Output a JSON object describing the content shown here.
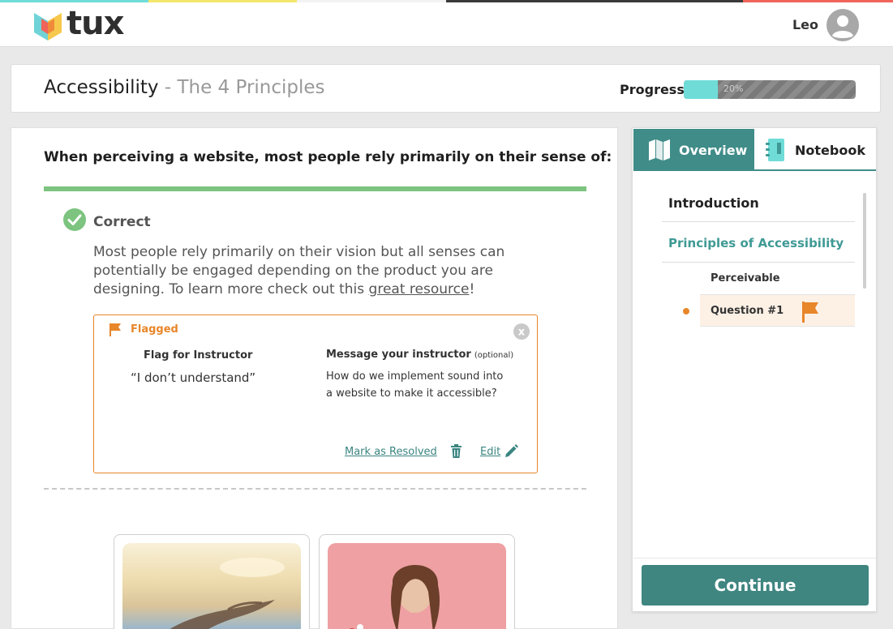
{
  "app": {
    "logo_text": "tux",
    "username": "Leo"
  },
  "course": {
    "title": "Accessibility",
    "subtitle": " - The 4 Principles"
  },
  "progress": {
    "label": "Progress",
    "value_text": "20%",
    "value": 0.2
  },
  "question": {
    "text": "When perceiving a website, most people rely primarily on their sense of:",
    "result": "Correct",
    "explanation": "Most people rely primarily on their vision but all senses can potentially be engaged depending on the product you are designing. To learn more check out this ",
    "link_text": "great resource",
    "explanation_end": "!"
  },
  "flag": {
    "status": "Flagged",
    "close_glyph": "x",
    "flag_for_instructor_label": "Flag for Instructor",
    "flag_reason": "“I don’t understand”",
    "message_label": "Message your instructor",
    "optional_label": "(optional)",
    "message": "How do we implement sound into a website to make it accessible?",
    "resolve_label": "Mark as Resolved",
    "edit_label": "Edit"
  },
  "sidebar": {
    "tabs": [
      {
        "label": "Overview",
        "icon": "map-icon",
        "active": true
      },
      {
        "label": "Notebook",
        "icon": "notebook-icon",
        "active": false
      }
    ],
    "nav": {
      "introduction": "Introduction",
      "section": "Principles of Accessibility",
      "subsection": "Perceivable",
      "current_item": "Question #1"
    },
    "continue_label": "Continue"
  },
  "colors": {
    "teal": "#3f8580",
    "teal_light": "#6fdcd8",
    "orange": "#e8862a",
    "green": "#7cc47f",
    "stripes": [
      "#6fdcd8",
      "#f2e66b",
      "#ffffff",
      "#3a3a3a",
      "#3a3a3a",
      "#f0645a"
    ]
  }
}
